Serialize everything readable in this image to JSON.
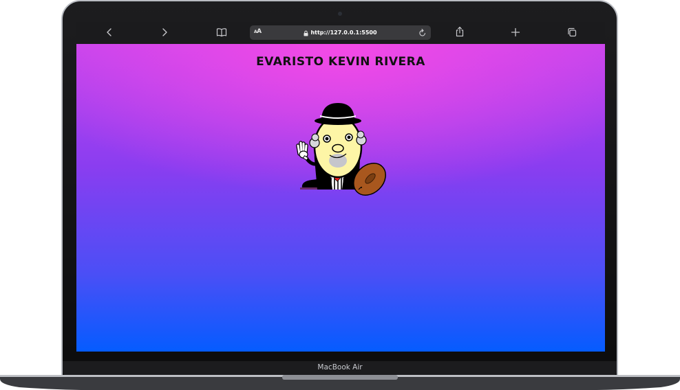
{
  "browser": {
    "url": "http://127.0.0.1:5500",
    "text_size_label": "AA"
  },
  "page": {
    "title": "EVARISTO KEVIN RIVERA"
  },
  "device": {
    "label": "MacBook Air"
  },
  "icons": {
    "back": "chevron-left-icon",
    "forward": "chevron-right-icon",
    "bookmarks": "book-icon",
    "lock": "lock-icon",
    "reload": "reload-icon",
    "share": "share-icon",
    "new_tab": "plus-icon",
    "tabs": "tabs-icon"
  },
  "colors": {
    "page_gradient_top": "#f44ae6",
    "page_gradient_bottom": "#055cff",
    "title_text": "#111111"
  }
}
